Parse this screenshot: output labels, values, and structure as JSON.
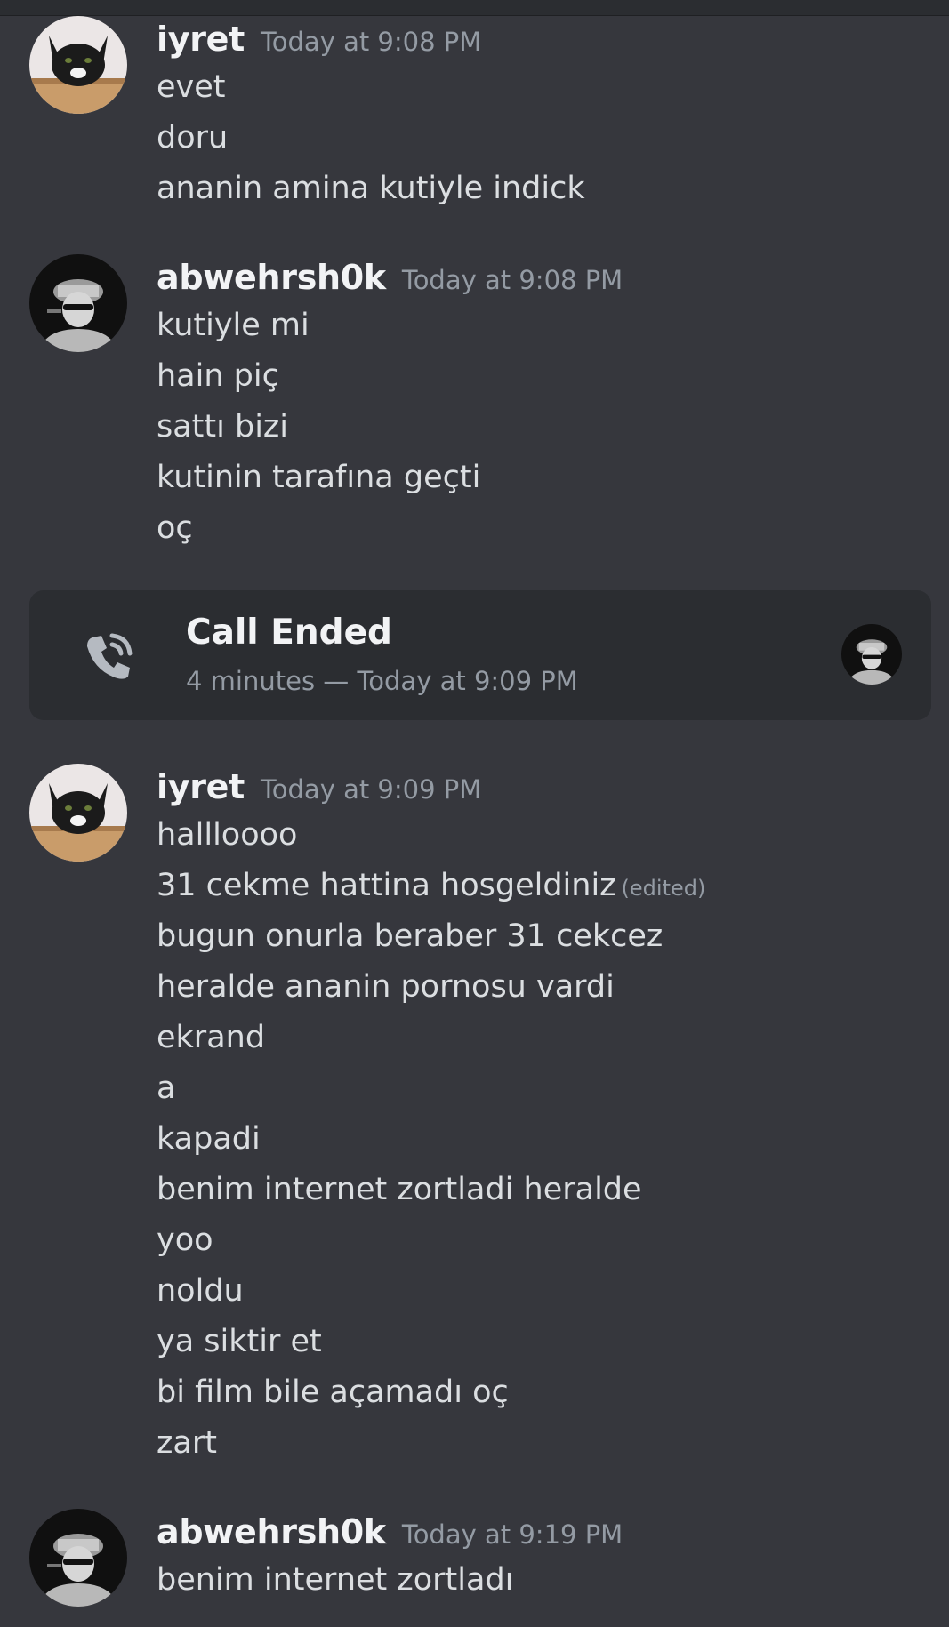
{
  "messages": [
    {
      "username": "iyret",
      "timestamp": "Today at 9:08 PM",
      "avatar": "cat-icon",
      "lines": [
        "evet",
        "doru",
        "ananin amina kutiyle indick"
      ]
    },
    {
      "username": "abwehrsh0k",
      "timestamp": "Today at 9:08 PM",
      "avatar": "officer-icon",
      "lines": [
        "kutiyle mi",
        "hain piç",
        "sattı bizi",
        "kutinin tarafına geçti",
        "oç"
      ]
    },
    {
      "username": "iyret",
      "timestamp": "Today at 9:09 PM",
      "avatar": "cat-icon",
      "lines": [
        "halllоооо",
        "31 cekme hattina hosgeldiniz",
        "bugun onurla beraber 31 cekcez",
        "heralde ananin pornosu vardi",
        "ekrand",
        "a",
        "kapadi",
        "benim internet zortladi heralde",
        "yoo",
        "noldu",
        "ya siktir et",
        "bi film bile açamadı oç",
        "zart"
      ],
      "edited_label": "(edited)"
    },
    {
      "username": "abwehrsh0k",
      "timestamp": "Today at 9:19 PM",
      "avatar": "officer-icon",
      "lines": [
        "benim internet zortladı"
      ]
    }
  ],
  "call": {
    "title": "Call Ended",
    "subtitle": "4 minutes — Today at 9:09 PM",
    "icon": "phone-call-icon"
  },
  "colors": {
    "background": "#36373d",
    "card": "#2b2d31",
    "username": "#f2f3f5",
    "text": "#dbdee1",
    "muted": "#949ba4"
  }
}
